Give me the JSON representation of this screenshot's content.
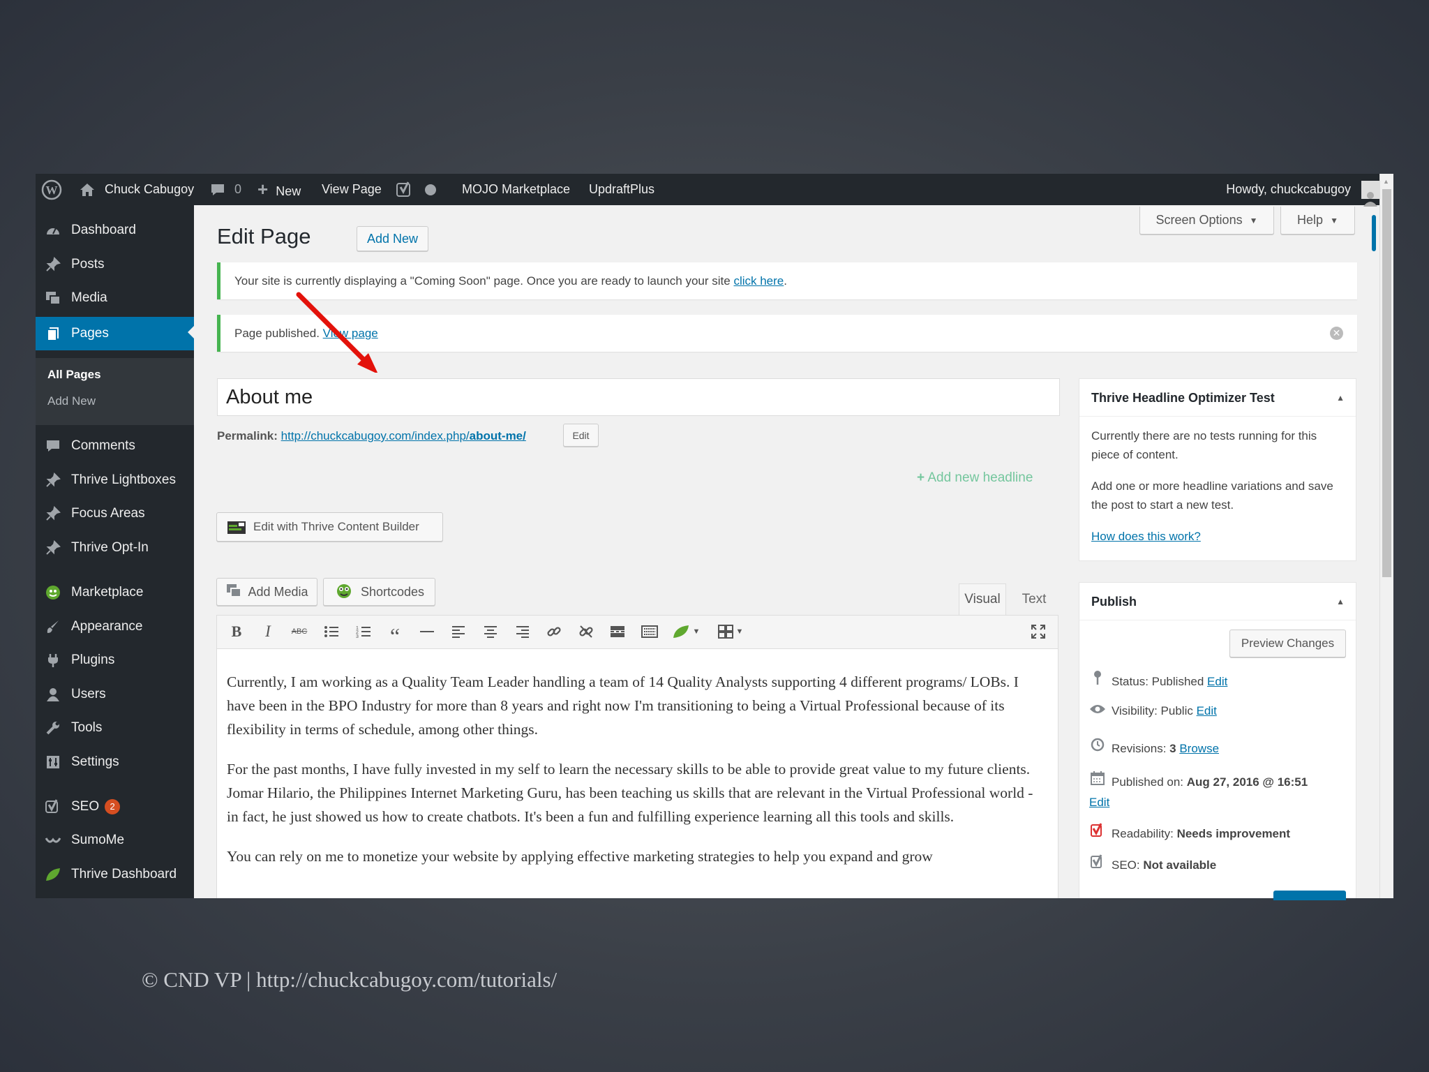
{
  "adminbar": {
    "site_name": "Chuck Cabugoy",
    "comments_count": "0",
    "new_label": "New",
    "view_page": "View Page",
    "mojo": "MOJO Marketplace",
    "updraft": "UpdraftPlus",
    "howdy": "Howdy, chuckcabugoy"
  },
  "sidebar": {
    "items": [
      {
        "label": "Dashboard",
        "icon": "dashboard-icon"
      },
      {
        "label": "Posts",
        "icon": "pin-icon"
      },
      {
        "label": "Media",
        "icon": "media-icon"
      },
      {
        "label": "Pages",
        "icon": "pages-icon"
      },
      {
        "label": "Comments",
        "icon": "comments-icon"
      },
      {
        "label": "Thrive Lightboxes",
        "icon": "pin-icon"
      },
      {
        "label": "Focus Areas",
        "icon": "pin-icon"
      },
      {
        "label": "Thrive Opt-In",
        "icon": "pin-icon"
      },
      {
        "label": "Marketplace",
        "icon": "marketplace-icon"
      },
      {
        "label": "Appearance",
        "icon": "brush-icon"
      },
      {
        "label": "Plugins",
        "icon": "plugin-icon"
      },
      {
        "label": "Users",
        "icon": "users-icon"
      },
      {
        "label": "Tools",
        "icon": "wrench-icon"
      },
      {
        "label": "Settings",
        "icon": "settings-icon"
      },
      {
        "label": "SEO",
        "icon": "yoast-icon",
        "badge": "2"
      },
      {
        "label": "SumoMe",
        "icon": "sumome-icon"
      },
      {
        "label": "Thrive Dashboard",
        "icon": "leaf-icon"
      }
    ],
    "submenu": [
      "All Pages",
      "Add New"
    ]
  },
  "header": {
    "title": "Edit Page",
    "add_new": "Add New",
    "screen_options": "Screen Options",
    "help": "Help"
  },
  "notices": {
    "coming_soon_text": "Your site is currently displaying a \"Coming Soon\" page. Once you are ready to launch your site ",
    "coming_soon_link": "click here",
    "coming_soon_end": ".",
    "published_text": "Page published. ",
    "published_link": "View page"
  },
  "editor": {
    "title_value": "About me",
    "permalink_label": "Permalink:",
    "permalink_base": "http://chuckcabugoy.com/index.php/",
    "permalink_slug": "about-me/",
    "permalink_edit": "Edit",
    "add_headline": "Add new headline",
    "thrive_builder": "Edit with Thrive Content Builder",
    "add_media": "Add Media",
    "shortcodes": "Shortcodes",
    "tab_visual": "Visual",
    "tab_text": "Text",
    "paragraphs": [
      "Currently, I am working as a Quality Team Leader handling a team of 14 Quality Analysts supporting 4 different programs/ LOBs. I have been in the BPO Industry for more than 8 years and right now I'm transitioning to being a Virtual Professional because of its flexibility in terms of schedule, among other things.",
      "For the past months, I have fully invested in my self to learn the necessary skills to be able to provide great value to my future clients. Jomar Hilario, the Philippines Internet Marketing Guru, has been teaching us skills that are relevant in the Virtual Professional world - in fact, he just showed us how to create chatbots. It's been a fun and fulfilling experience learning all this tools and skills.",
      "You can rely on me to monetize your website by applying effective marketing strategies to help you expand and grow"
    ]
  },
  "thrive_box": {
    "title": "Thrive Headline Optimizer Test",
    "text1": "Currently there are no tests running for this piece of content.",
    "text2": "Add one or more headline variations and save the post to start a new test.",
    "link": "How does this work?"
  },
  "publish_box": {
    "title": "Publish",
    "preview": "Preview Changes",
    "status_label": "Status: Published",
    "status_edit": "Edit",
    "visibility_label": "Visibility: Public",
    "visibility_edit": "Edit",
    "revisions_label": "Revisions: ",
    "revisions_count": "3",
    "revisions_browse": "Browse",
    "published_label": "Published on: ",
    "published_date": "Aug 27, 2016 @ 16:51",
    "published_edit": "Edit",
    "readability_label": "Readability: ",
    "readability_value": "Needs improvement",
    "seo_label": "SEO: ",
    "seo_value": "Not available"
  },
  "footer": {
    "caption": "© CND VP | http://chuckcabugoy.com/tutorials/"
  },
  "colors": {
    "accent": "#0073aa",
    "adminbar": "#23282d",
    "notice_green": "#46b450",
    "arrow": "#e3120b"
  }
}
